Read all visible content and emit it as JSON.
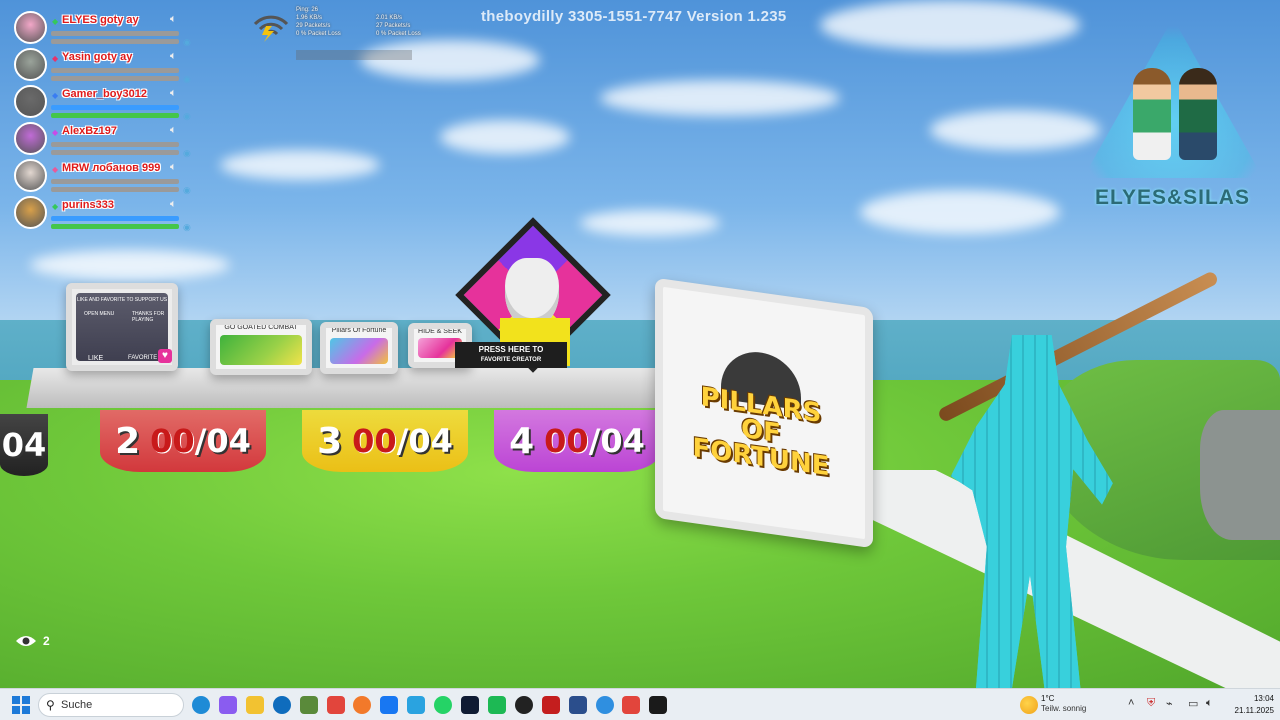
{
  "hud": {
    "players": [
      {
        "name": "ELYES goty ay",
        "dot_color": "#35c85a",
        "health": 0.0,
        "shield": 0.0,
        "avatar_color": "#f2a7c8"
      },
      {
        "name": "Yasin goty ay",
        "dot_color": "#e8336a",
        "health": 0.0,
        "shield": 0.0,
        "avatar_color": "#9aa39a"
      },
      {
        "name": "Gamer_boy3012",
        "dot_color": "#3a7df2",
        "health": 1.0,
        "shield": 1.0,
        "avatar_color": "#6a6a6a"
      },
      {
        "name": "AlexBz197",
        "dot_color": "#c84be8",
        "health": 0.0,
        "shield": 0.0,
        "avatar_color": "#c06bd6"
      },
      {
        "name": "MRW лобанов 999",
        "dot_color": "#e85a9a",
        "health": 0.0,
        "shield": 0.0,
        "avatar_color": "#e2d7d0"
      },
      {
        "name": "purins333",
        "dot_color": "#35c85a",
        "health": 1.0,
        "shield": 1.0,
        "avatar_color": "#d8a04a"
      }
    ],
    "network": {
      "ping": "Ping: 26",
      "down_rate": "1.96 KB/s",
      "down_packets": "29 Packets/s",
      "down_loss": "0 % Packet Loss",
      "up_rate": "2.01 KB/s",
      "up_packets": "27 Packets/s",
      "up_loss": "0 % Packet Loss"
    },
    "watermark": "theboydilly   3305-1551-7747 Version 1.235",
    "map_logo_text": "ELYES&SILAS",
    "spectators": "2"
  },
  "scene": {
    "platforms": [
      {
        "slot": "",
        "count": "",
        "rest": "04"
      },
      {
        "slot": "2",
        "count": "00",
        "rest": "/04"
      },
      {
        "slot": "3",
        "count": "00",
        "rest": "/04"
      },
      {
        "slot": "4",
        "count": "00",
        "rest": "/04"
      }
    ],
    "boards": {
      "support": {
        "title": "LIKE AND FAVORITE TO SUPPORT US",
        "open_menu": "OPEN MENU",
        "thanks": "THANKS FOR PLAYING",
        "like": "LIKE",
        "favorite": "FAVORITE"
      },
      "board2": "GO GOATED COMBAT",
      "board3": "Pillars Of Fortune",
      "board4": "HIDE & SEEK"
    },
    "press": {
      "line1": "PRESS HERE TO",
      "line2": "FAVORITE CREATOR"
    },
    "pillars_title": "PILLARS OF FORTUNE"
  },
  "taskbar": {
    "search_placeholder": "Suche",
    "weather_temp": "1°C",
    "weather_cond": "Teilw. sonnig",
    "time": "13:04",
    "date": "21.11.2025",
    "apps": [
      {
        "name": "edge",
        "color": "#1f8bd6"
      },
      {
        "name": "copilot",
        "color": "#8a5cf0"
      },
      {
        "name": "file-explorer",
        "color": "#f2c231"
      },
      {
        "name": "outlook",
        "color": "#0f6cbd"
      },
      {
        "name": "minecraft",
        "color": "#5a8a3a"
      },
      {
        "name": "chrome",
        "color": "#e2453c"
      },
      {
        "name": "firefox",
        "color": "#f2792a"
      },
      {
        "name": "facebook",
        "color": "#1877f2"
      },
      {
        "name": "telegram",
        "color": "#2aa3e0"
      },
      {
        "name": "whatsapp",
        "color": "#25d366"
      },
      {
        "name": "photoshop",
        "color": "#0f1b33"
      },
      {
        "name": "spotify",
        "color": "#1db954"
      },
      {
        "name": "app-dark",
        "color": "#222222"
      },
      {
        "name": "app-red",
        "color": "#c41e1e"
      },
      {
        "name": "app-blue-dark",
        "color": "#2b4e8c"
      },
      {
        "name": "fortnite",
        "color": "#2f8fe0"
      },
      {
        "name": "chrome-2",
        "color": "#e2453c"
      },
      {
        "name": "chatgpt",
        "color": "#1a1a1a"
      }
    ]
  }
}
